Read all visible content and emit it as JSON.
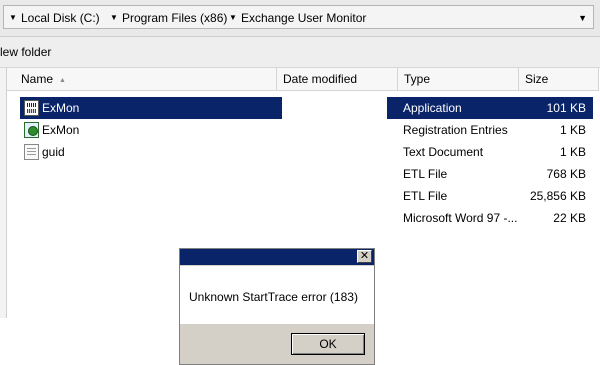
{
  "address_bar": {
    "crumbs": [
      "Local Disk (C:)",
      "Program Files (x86)",
      "Exchange User Monitor"
    ]
  },
  "toolbar": {
    "new_folder_label": "lew folder"
  },
  "columns": {
    "name": "Name",
    "date_modified": "Date modified",
    "type": "Type",
    "size": "Size"
  },
  "files": [
    {
      "name": "ExMon",
      "icon": "application-icon",
      "type": "Application",
      "size": "101 KB",
      "selected": true
    },
    {
      "name": "ExMon",
      "icon": "registration-icon",
      "type": "Registration Entries",
      "size": "1 KB"
    },
    {
      "name": "guid",
      "icon": "text-document-icon",
      "type": "Text Document",
      "size": "1 KB"
    },
    {
      "name": "",
      "type": "ETL File",
      "size": "768 KB"
    },
    {
      "name": "",
      "type": "ETL File",
      "size": "25,856 KB"
    },
    {
      "name": "",
      "type": "Microsoft Word 97 -...",
      "size": "22 KB"
    }
  ],
  "dialog": {
    "close_glyph": "✕",
    "message": "Unknown StartTrace error (183)",
    "ok_label": "OK"
  },
  "colors": {
    "selection": "#0a246a",
    "dialog_face": "#d4d0c8"
  }
}
